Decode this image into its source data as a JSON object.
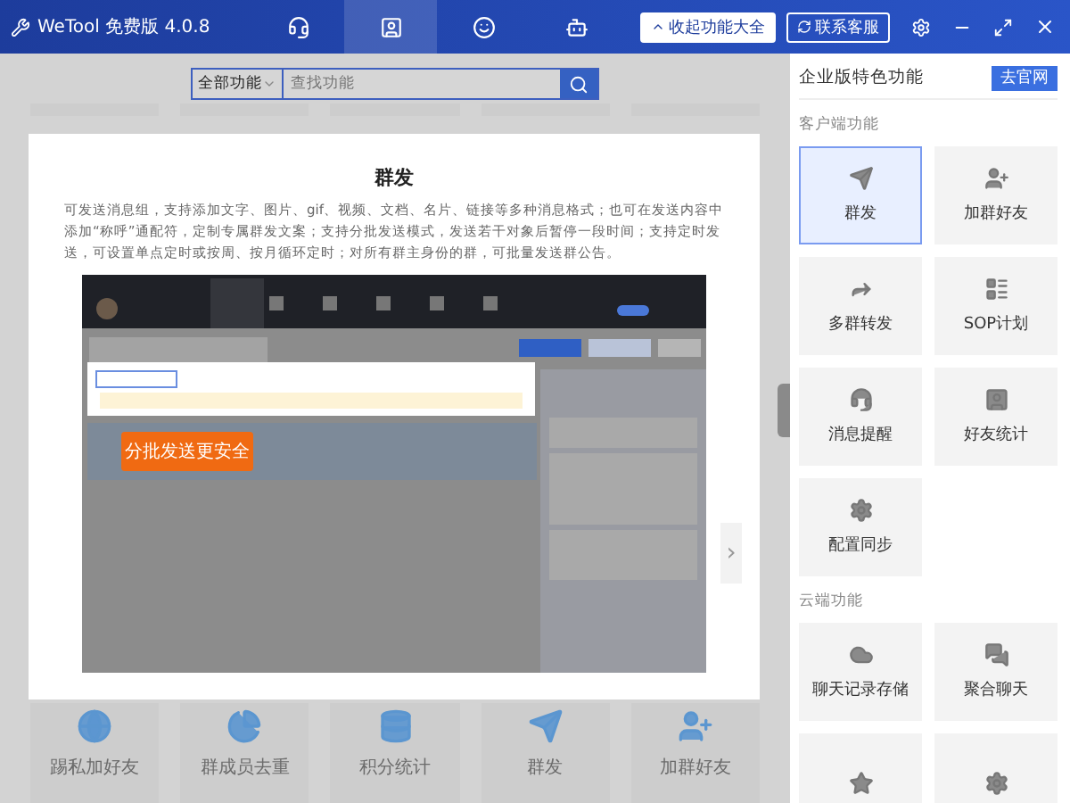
{
  "window": {
    "title": "WeTool 免费版 4.0.8"
  },
  "nav_tabs": [
    {
      "selected": false
    },
    {
      "selected": true
    },
    {
      "selected": false
    },
    {
      "selected": false
    }
  ],
  "header_buttons": [
    {
      "label": "收起功能大全",
      "kind": "primary"
    },
    {
      "label": "联系客服",
      "kind": "outline"
    }
  ],
  "search": {
    "category": "全部功能",
    "placeholder": "查找功能"
  },
  "feature_tiles": [
    {
      "label": "踢私加好友"
    },
    {
      "label": "群成员去重"
    },
    {
      "label": "积分统计"
    },
    {
      "label": "群发"
    },
    {
      "label": "加群好友"
    }
  ],
  "modal": {
    "title": "群发",
    "description": "可发送消息组，支持添加文字、图片、gif、视频、文档、名片、链接等多种消息格式；也可在发送内容中添加“称呼”通配符，定制专属群发文案；支持分批发送模式，发送若干对象后暂停一段时间；支持定时发送，可设置单点定时或按周、按月循环定时；对所有群主身份的群，可批量发送群公告。",
    "callout": "分批发送更安全",
    "next": "›"
  },
  "side_panel": {
    "title": "企业版特色功能",
    "button": "去官网",
    "sections": [
      {
        "title": "客户端功能",
        "items": [
          {
            "label": "群发",
            "selected": true
          },
          {
            "label": "加群好友",
            "selected": false
          },
          {
            "label": "多群转发",
            "selected": false
          },
          {
            "label": "SOP计划",
            "selected": false
          },
          {
            "label": "消息提醒",
            "selected": false
          },
          {
            "label": "好友统计",
            "selected": false
          },
          {
            "label": "配置同步",
            "selected": false
          }
        ]
      },
      {
        "title": "云端功能",
        "items": [
          {
            "label": "聊天记录存储",
            "selected": false
          },
          {
            "label": "聚合聊天",
            "selected": false
          },
          {
            "selected": false
          },
          {
            "selected": false
          }
        ]
      }
    ]
  }
}
